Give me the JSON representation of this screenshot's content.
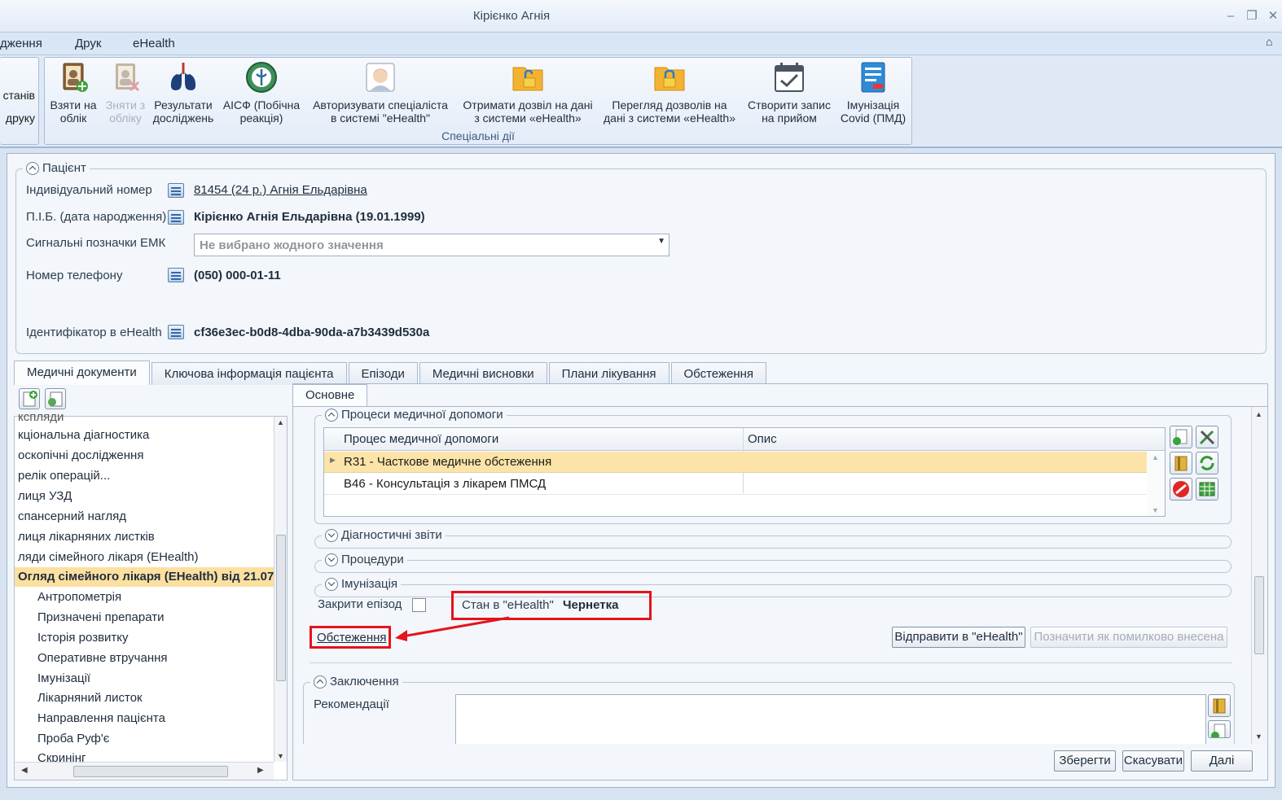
{
  "window": {
    "title": "Кірієнко Агнія"
  },
  "menu": {
    "items": [
      "дження",
      "Друк",
      "eHealth"
    ]
  },
  "ribbon": {
    "left_partial": [
      "станів",
      "друку"
    ],
    "buttons": [
      {
        "label": "Взяти на\nоблік",
        "icon": "register-book-icon",
        "disabled": false
      },
      {
        "label": "Зняти з\nобліку",
        "icon": "unregister-book-icon",
        "disabled": true
      },
      {
        "label": "Результати\nдосліджень",
        "icon": "lungs-icon",
        "disabled": false
      },
      {
        "label": "АІСФ (Побічна\nреакція)",
        "icon": "aisf-emblem-icon",
        "disabled": false
      },
      {
        "label": "Авторизувати спеціаліста\nв системі \"eHealth\"",
        "icon": "specialist-avatar-icon",
        "disabled": false
      },
      {
        "label": "Отримати дозвіл на дані\nз системи «eHealth»",
        "icon": "folder-unlock-icon",
        "disabled": false
      },
      {
        "label": "Перегляд дозволів на\nдані з системи «eHealth»",
        "icon": "folder-lock-icon",
        "disabled": false
      },
      {
        "label": "Створити запис\nна прийом",
        "icon": "calendar-check-icon",
        "disabled": false
      },
      {
        "label": "Імунізація\nCovid (ПМД)",
        "icon": "covid-doc-icon",
        "disabled": false
      }
    ],
    "group_label": "Спеціальні дії"
  },
  "patient": {
    "legend": "Пацієнт",
    "fields": {
      "id_label": "Індивідуальний номер",
      "id_value": "81454 (24 р.) Агнія Ельдарівна",
      "name_label": "П.І.Б. (дата народження)",
      "name_value": "Кірієнко Агнія Ельдарівна (19.01.1999)",
      "flags_label": "Сигнальні позначки ЕМК",
      "flags_placeholder": "Не вибрано жодного значення",
      "phone_label": "Номер телефону",
      "phone_value": "(050) 000-01-11",
      "ehealth_label": "Ідентифікатор в eHealth",
      "ehealth_value": "cf36e3ec-b0d8-4dba-90da-a7b3439d530a"
    }
  },
  "tabs": [
    "Медичні документи",
    "Ключова інформація пацієнта",
    "Епізоди",
    "Медичні висновки",
    "Плани лікування",
    "Обстеження"
  ],
  "tree": {
    "items": [
      "кспляди",
      "кціональна діагностика",
      "оскопічні дослідження",
      "релік операцій...",
      "лиця УЗД",
      "спансерний нагляд",
      "лиця лікарняних листків",
      "ляди сімейного лікаря (EHealth)",
      "Огляд сімейного лікаря (EHealth) від 21.07"
    ],
    "children": [
      "Антропометрія",
      "Призначені препарати",
      "Історія розвитку",
      "Оперативне втручання",
      "Імунізації",
      "Лікарняний листок",
      "Направлення пацієнта",
      "Проба Руф'є",
      "Скринінг"
    ]
  },
  "subtab": "Основне",
  "processes": {
    "legend": "Процеси медичної допомоги",
    "col1": "Процес медичної допомоги",
    "col2": "Опис",
    "rows": [
      "R31 - Часткове медичне обстеження",
      "B46 - Консультація з лікарем ПМСД"
    ]
  },
  "sections": {
    "diag": "Діагностичні звіти",
    "proc": "Процедури",
    "imm": "Імунізація"
  },
  "episode": {
    "close_label": "Закрити епізод",
    "state_label": "Стан в \"eHealth\"",
    "state_value": "Чернетка",
    "exam_link": "Обстеження"
  },
  "actions": {
    "send": "Відправити в \"eHealth\"",
    "mark_err": "Позначити як помилково внесена"
  },
  "conclusion": {
    "legend": "Заключення",
    "rec_label": "Рекомендації"
  },
  "footer": {
    "save": "Зберегти",
    "cancel": "Скасувати",
    "next": "Далі"
  }
}
